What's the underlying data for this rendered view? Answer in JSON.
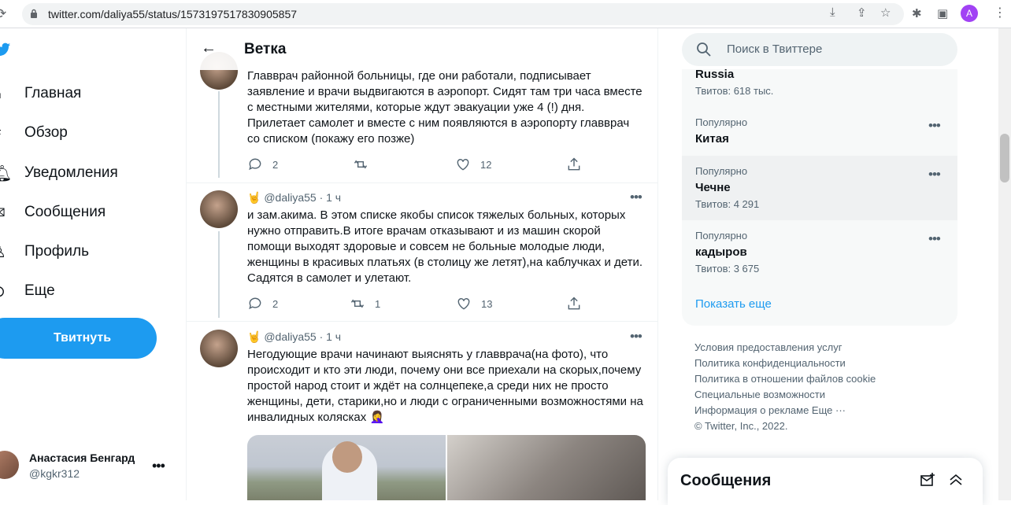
{
  "browser": {
    "url": "twitter.com/daliya55/status/1573197517830905857",
    "profile_initial": "A",
    "profile_color": "#a142f4"
  },
  "nav": {
    "items": [
      {
        "label": "Главная",
        "icon": "home-icon"
      },
      {
        "label": "Обзор",
        "icon": "hashtag-icon"
      },
      {
        "label": "Уведомления",
        "icon": "bell-icon"
      },
      {
        "label": "Сообщения",
        "icon": "mail-icon"
      },
      {
        "label": "Профиль",
        "icon": "person-icon"
      },
      {
        "label": "Еще",
        "icon": "more-circle-icon"
      }
    ],
    "tweet_button": "Твитнуть",
    "account": {
      "name": "Анастасия Бенгард",
      "handle": "@kgkr312"
    }
  },
  "thread": {
    "title": "Ветка",
    "tweets": [
      {
        "text": "Главврач районной больницы, где они работали, подписывает заявление и врачи выдвигаются в аэропорт. Сидят там три часа вместе с местными жителями, которые ждут эвакуации уже 4 (!) дня. Прилетает самолет и вместе с ним появляются в аэропорту главврач со списком (покажу его позже)",
        "replies": "2",
        "retweets": "",
        "likes": "12"
      },
      {
        "author": "🤘 @daliya55 · 1 ч",
        "text": "и зам.акима. В этом списке якобы список тяжелых больных, которых нужно отправить.В итоге врачам отказывают и из машин скорой помощи выходят здоровые и совсем не больные молодые люди, женщины в красивых платьях (в столицу же летят),на каблучках и дети. Садятся в самолет и улетают.",
        "replies": "2",
        "retweets": "1",
        "likes": "13"
      },
      {
        "author": "🤘 @daliya55 · 1 ч",
        "text": "Негодующие врачи начинают выяснять у главврача(на фото), что происходит и кто эти люди, почему они все приехали на скорых,почему простой народ стоит и ждёт на солнцепеке,а среди них не просто женщины, дети, старики,но и люди с ограниченными возможностями на инвалидных колясках 🤦‍♀️"
      }
    ]
  },
  "sidebar": {
    "search_placeholder": "Поиск в Твиттере",
    "trends": [
      {
        "category": "",
        "name": "Russia",
        "count": "Твитов: 618 тыс."
      },
      {
        "category": "Популярно",
        "name": "Китая",
        "count": ""
      },
      {
        "category": "Популярно",
        "name": "Чечне",
        "count": "Твитов: 4 291"
      },
      {
        "category": "Популярно",
        "name": "кадыров",
        "count": "Твитов: 3 675"
      }
    ],
    "show_more": "Показать еще",
    "footer": [
      "Условия предоставления услуг",
      "Политика конфиденциальности",
      "Политика в отношении файлов cookie",
      "Специальные возможности",
      "Информация о рекламе    Еще ···",
      "© Twitter, Inc., 2022."
    ],
    "messages_title": "Сообщения"
  },
  "colors": {
    "accent": "#1d9bf0",
    "text": "#0f1419",
    "muted": "#536471"
  }
}
